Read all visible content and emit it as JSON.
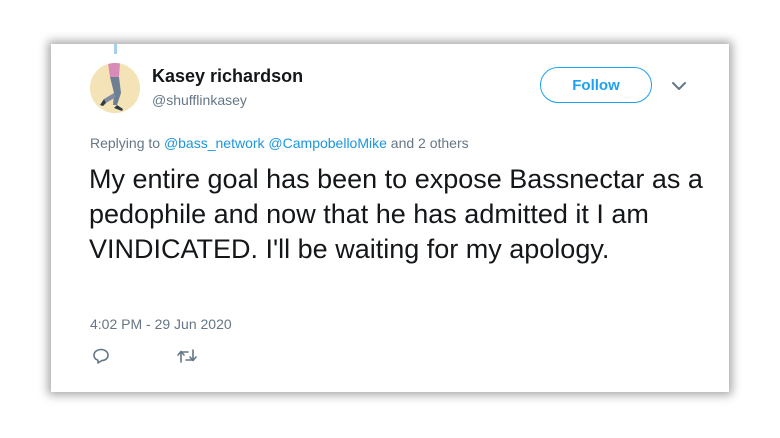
{
  "tweet": {
    "author_name": "Kasey richardson",
    "handle": "@shufflinkasey",
    "follow_label": "Follow",
    "replying_prefix": "Replying to",
    "replying_mentions": [
      "@bass_network",
      "@CampobelloMike"
    ],
    "replying_others": "and 2 others",
    "text": "My entire goal has been to expose Bassnectar as a pedophile and now that he has admitted it I am VINDICATED. I'll be waiting for my apology.",
    "timestamp": "4:02 PM - 29 Jun 2020"
  },
  "icons": {
    "more": "chevron-down-icon",
    "reply": "reply-icon",
    "retweet": "retweet-icon"
  },
  "colors": {
    "accent": "#1da1f2",
    "link": "#1b95e0",
    "secondary_text": "#657786",
    "primary_text": "#14171a"
  }
}
